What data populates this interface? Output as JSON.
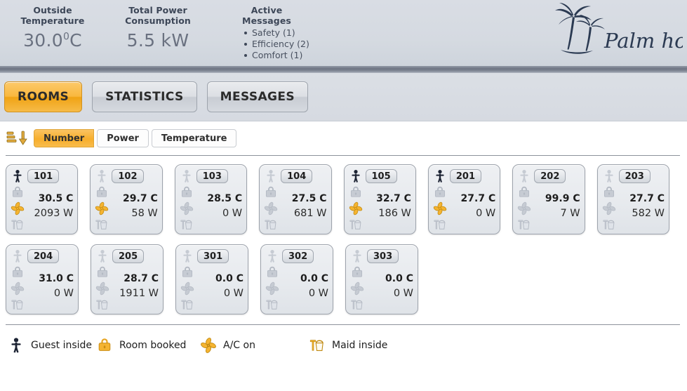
{
  "header": {
    "kpis": [
      {
        "title_line1": "Outside",
        "title_line2": "Temperature",
        "value": "30.0",
        "unit_sup": "0",
        "unit": "C"
      },
      {
        "title_line1": "Total Power",
        "title_line2": "Consumption",
        "value": "5.5 kW"
      },
      {
        "title_line1": "Active",
        "title_line2": "Messages"
      }
    ],
    "messages": [
      "Safety (1)",
      "Efficiency (2)",
      "Comfort (1)"
    ],
    "logo": {
      "name": "palm-hotel-logo",
      "text": "Palm hotel"
    }
  },
  "nav": {
    "tabs": [
      {
        "label": "ROOMS",
        "active": true
      },
      {
        "label": "STATISTICS",
        "active": false
      },
      {
        "label": "MESSAGES",
        "active": false
      }
    ]
  },
  "sortbar": {
    "icon": "sort-descending-icon",
    "options": [
      {
        "label": "Number",
        "active": true
      },
      {
        "label": "Power",
        "active": false
      },
      {
        "label": "Temperature",
        "active": false
      }
    ]
  },
  "rooms": [
    {
      "number": "101",
      "temperature": "30.5 C",
      "power": "2093 W",
      "guest": true,
      "booked": false,
      "ac": true,
      "maid": false
    },
    {
      "number": "102",
      "temperature": "29.7 C",
      "power": "58 W",
      "guest": false,
      "booked": false,
      "ac": true,
      "maid": false
    },
    {
      "number": "103",
      "temperature": "28.5 C",
      "power": "0 W",
      "guest": false,
      "booked": false,
      "ac": false,
      "maid": false
    },
    {
      "number": "104",
      "temperature": "27.5 C",
      "power": "681 W",
      "guest": false,
      "booked": false,
      "ac": false,
      "maid": false
    },
    {
      "number": "105",
      "temperature": "32.7 C",
      "power": "186 W",
      "guest": true,
      "booked": false,
      "ac": true,
      "maid": false
    },
    {
      "number": "201",
      "temperature": "27.7 C",
      "power": "0 W",
      "guest": true,
      "booked": false,
      "ac": true,
      "maid": false
    },
    {
      "number": "202",
      "temperature": "99.9 C",
      "power": "7 W",
      "guest": false,
      "booked": false,
      "ac": false,
      "maid": false
    },
    {
      "number": "203",
      "temperature": "27.7 C",
      "power": "582 W",
      "guest": false,
      "booked": false,
      "ac": false,
      "maid": false
    },
    {
      "number": "204",
      "temperature": "31.0 C",
      "power": "0 W",
      "guest": false,
      "booked": false,
      "ac": false,
      "maid": false
    },
    {
      "number": "205",
      "temperature": "28.7 C",
      "power": "1911 W",
      "guest": false,
      "booked": false,
      "ac": false,
      "maid": false
    },
    {
      "number": "301",
      "temperature": "0.0 C",
      "power": "0 W",
      "guest": false,
      "booked": false,
      "ac": false,
      "maid": false
    },
    {
      "number": "302",
      "temperature": "0.0 C",
      "power": "0 W",
      "guest": false,
      "booked": false,
      "ac": false,
      "maid": false
    },
    {
      "number": "303",
      "temperature": "0.0 C",
      "power": "0 W",
      "guest": false,
      "booked": false,
      "ac": false,
      "maid": false
    }
  ],
  "legend": [
    {
      "icon": "guest-person-icon",
      "label": "Guest inside"
    },
    {
      "icon": "briefcase-lock-icon",
      "label": "Room booked"
    },
    {
      "icon": "fan-ac-icon",
      "label": "A/C on"
    },
    {
      "icon": "maid-bucket-icon",
      "label": "Maid inside"
    }
  ],
  "colors": {
    "accent": "#f7ae2c",
    "header_bg": "#d5dae1",
    "icon_active_person": "#1c2333",
    "icon_active_orange": "#f0b030",
    "icon_inactive": "#c2c7cf",
    "text_dark": "#1d1d1d",
    "rule": "#8d929b"
  }
}
